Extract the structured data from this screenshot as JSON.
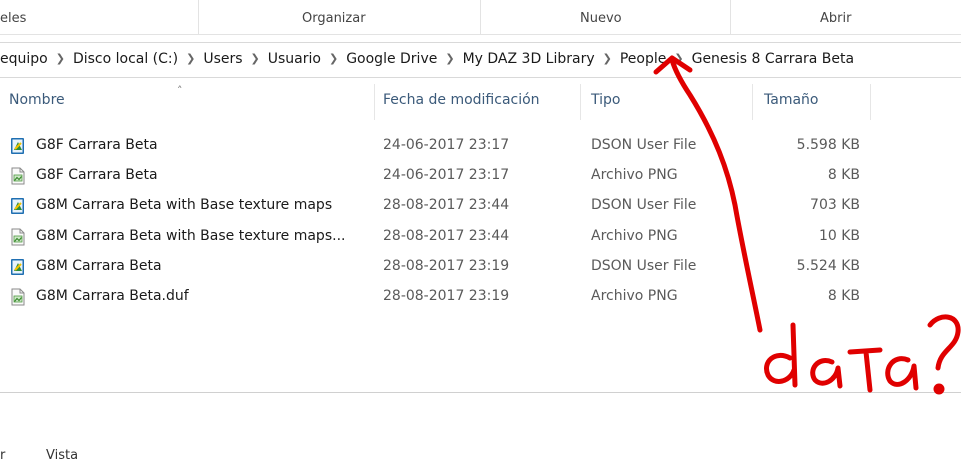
{
  "ribbon": {
    "groups": [
      "eles",
      "Organizar",
      "Nuevo",
      "Abrir"
    ]
  },
  "breadcrumb": [
    "equipo",
    "Disco local (C:)",
    "Users",
    "Usuario",
    "Google Drive",
    "My DAZ 3D Library",
    "People",
    "Genesis 8 Carrara Beta"
  ],
  "columns": {
    "name": "Nombre",
    "date": "Fecha de modificación",
    "type": "Tipo",
    "size": "Tamaño"
  },
  "files": [
    {
      "name": "G8F Carrara Beta",
      "date": "24-06-2017 23:17",
      "type": "DSON User File",
      "size": "5.598 KB",
      "icon": "dson-file-icon"
    },
    {
      "name": "G8F Carrara Beta",
      "date": "24-06-2017 23:17",
      "type": "Archivo PNG",
      "size": "8 KB",
      "icon": "png-file-icon"
    },
    {
      "name": "G8M Carrara Beta with Base texture maps",
      "date": "28-08-2017 23:44",
      "type": "DSON User File",
      "size": "703 KB",
      "icon": "dson-file-icon"
    },
    {
      "name": "G8M Carrara Beta with Base texture maps...",
      "date": "28-08-2017 23:44",
      "type": "Archivo PNG",
      "size": "10 KB",
      "icon": "png-file-icon"
    },
    {
      "name": "G8M Carrara Beta",
      "date": "28-08-2017 23:19",
      "type": "DSON User File",
      "size": "5.524 KB",
      "icon": "dson-file-icon"
    },
    {
      "name": "G8M Carrara Beta.duf",
      "date": "28-08-2017 23:19",
      "type": "Archivo PNG",
      "size": "8 KB",
      "icon": "png-file-icon"
    }
  ],
  "annotation": {
    "text": "data?",
    "color": "#e00000"
  },
  "bottom_tabs": [
    "r",
    "Vista"
  ]
}
